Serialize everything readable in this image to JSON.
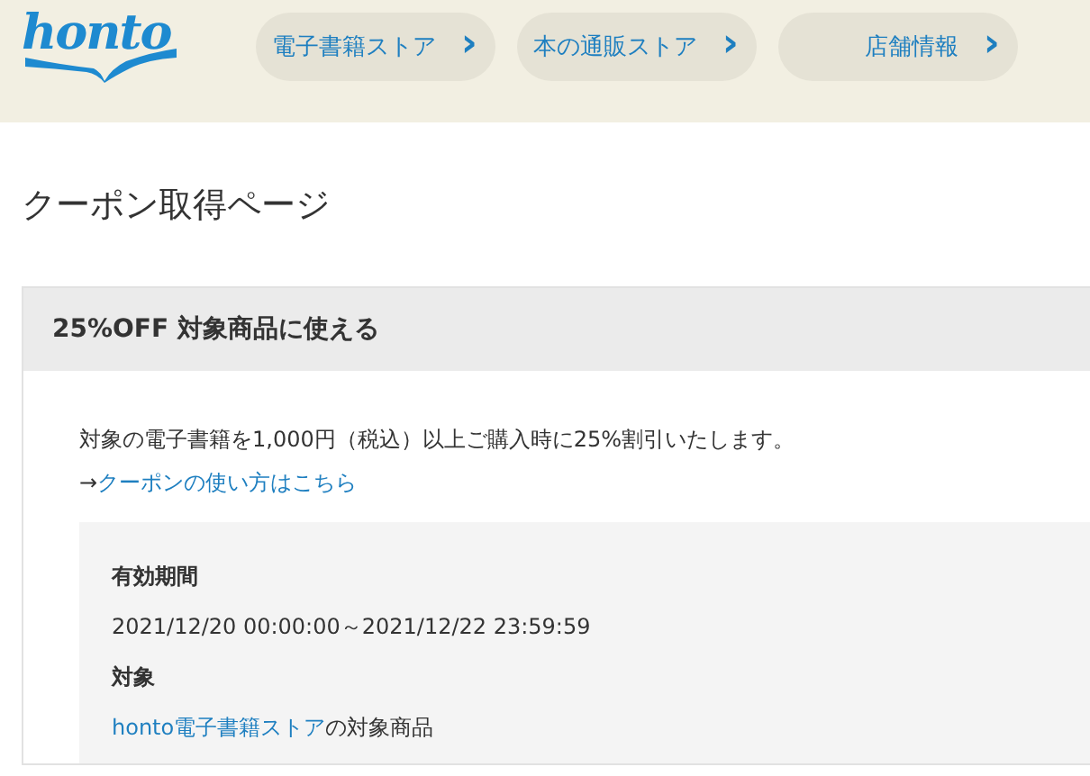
{
  "header": {
    "logo": "honto",
    "nav": [
      {
        "label": "電子書籍ストア",
        "chevron": "›"
      },
      {
        "label": "本の通販ストア",
        "chevron": "›"
      },
      {
        "label": "店舗情報",
        "chevron": "›"
      }
    ]
  },
  "page_title": "クーポン取得ページ",
  "coupon": {
    "title": "25%OFF 対象商品に使える",
    "description": "対象の電子書籍を1,000円（税込）以上ご購入時に25%割引いたします。",
    "help_prefix": "→",
    "help_link": "クーポンの使い方はこちら",
    "details": [
      {
        "kind": "text",
        "label": "有効期間",
        "value": "2021/12/20 00:00:00～2021/12/22 23:59:59"
      },
      {
        "kind": "link",
        "label": "対象",
        "link": "honto電子書籍ストア",
        "value": "の対象商品"
      }
    ]
  }
}
